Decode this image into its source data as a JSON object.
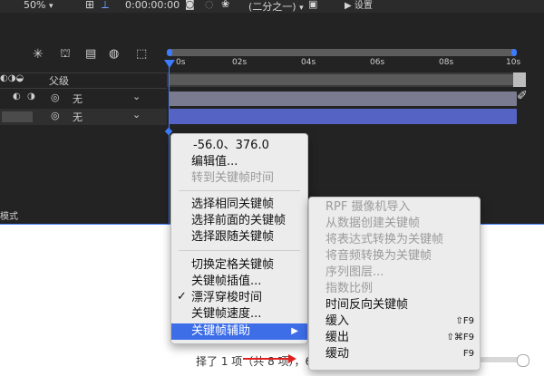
{
  "toolbar": {
    "zoom": "50%",
    "timecode": "0:00:00:00",
    "resolution": "(二分之一)",
    "right_tab": "▶ 设置"
  },
  "timeline": {
    "parent_header": "父级",
    "layers": [
      {
        "parent": "无"
      },
      {
        "parent": "无"
      }
    ],
    "ticks": [
      "0s",
      "02s",
      "04s",
      "06s",
      "08s",
      "10s"
    ],
    "mode_label": "模式"
  },
  "status_text": "择了 1 项（共 8 项），62",
  "context_menu": {
    "items": [
      {
        "label": "-56.0、376.0",
        "disabled": false
      },
      {
        "label": "编辑值...",
        "disabled": false
      },
      {
        "label": "转到关键帧时间",
        "disabled": true
      },
      {
        "label": "选择相同关键帧",
        "disabled": false
      },
      {
        "label": "选择前面的关键帧",
        "disabled": false
      },
      {
        "label": "选择跟随关键帧",
        "disabled": false
      },
      {
        "label": "切换定格关键帧",
        "disabled": false
      },
      {
        "label": "关键帧插值...",
        "disabled": false
      },
      {
        "label": "漂浮穿梭时间",
        "disabled": false,
        "checked": true
      },
      {
        "label": "关键帧速度...",
        "disabled": false
      },
      {
        "label": "关键帧辅助",
        "disabled": false,
        "highlighted": true
      }
    ]
  },
  "submenu": {
    "items": [
      {
        "label": "RPF 摄像机导入",
        "disabled": true
      },
      {
        "label": "从数据创建关键帧",
        "disabled": true
      },
      {
        "label": "将表达式转换为关键帧",
        "disabled": true
      },
      {
        "label": "将音频转换为关键帧",
        "disabled": true
      },
      {
        "label": "序列图层...",
        "disabled": true
      },
      {
        "label": "指数比例",
        "disabled": true
      },
      {
        "label": "时间反向关键帧",
        "disabled": false
      },
      {
        "label": "缓入",
        "disabled": false,
        "shortcut": "⇧F9"
      },
      {
        "label": "缓出",
        "disabled": false,
        "shortcut": "⇧⌘F9"
      },
      {
        "label": "缓动",
        "disabled": false,
        "shortcut": "F9"
      }
    ]
  }
}
